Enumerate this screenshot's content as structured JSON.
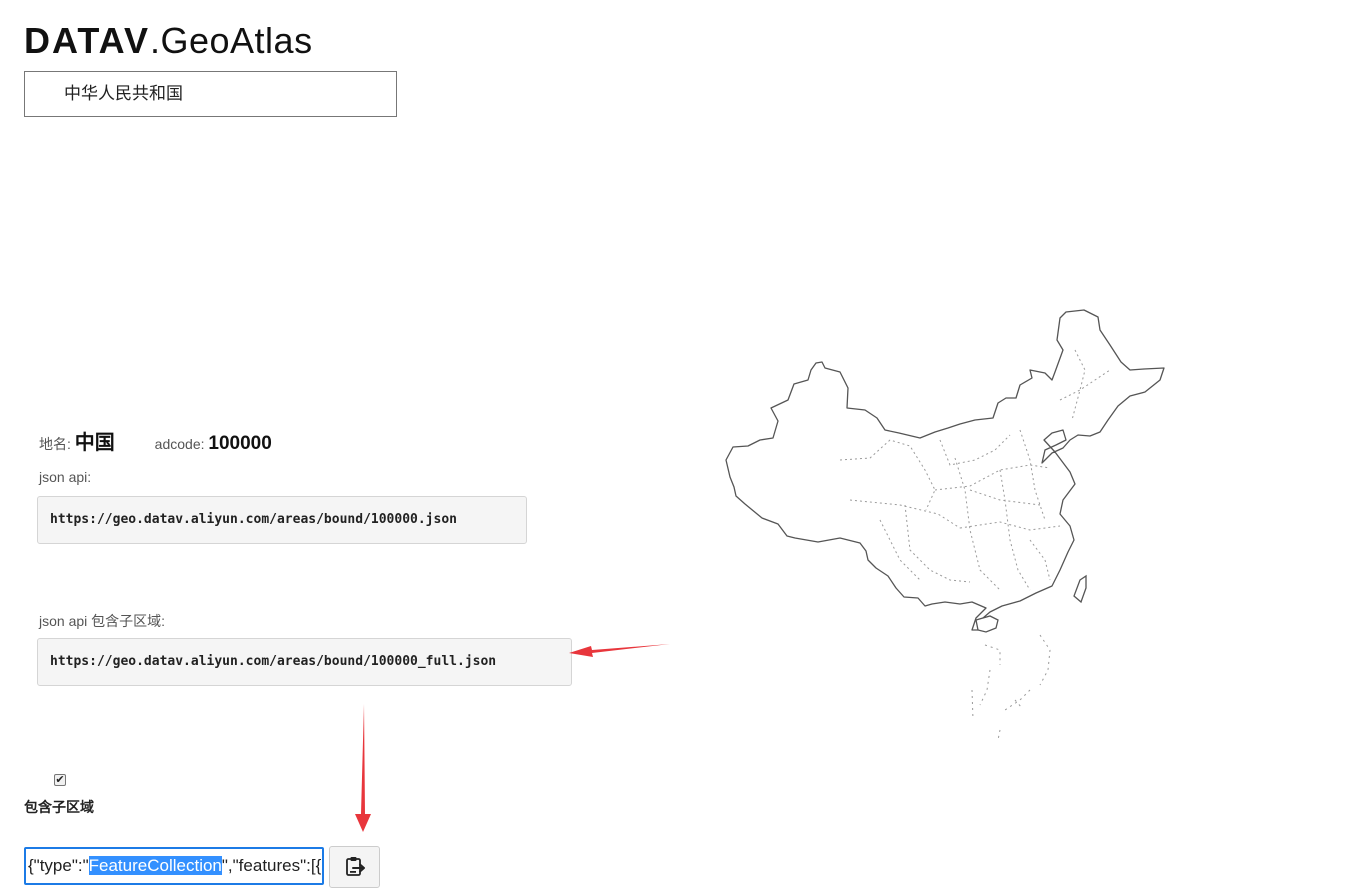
{
  "logo": {
    "brand": "DATAV",
    "product": ".GeoAtlas"
  },
  "region_select": {
    "value": "中华人民共和国"
  },
  "info": {
    "name_label": "地名:",
    "name_value": "中国",
    "adcode_label": "adcode:",
    "adcode_value": "100000"
  },
  "api": {
    "label": "json api:",
    "url": "https://geo.datav.aliyun.com/areas/bound/100000.json"
  },
  "api_full": {
    "label": "json api 包含子区域:",
    "url": "https://geo.datav.aliyun.com/areas/bound/100000_full.json"
  },
  "include_children": {
    "checked": true,
    "label": "包含子区域"
  },
  "json_output": {
    "prefix": "{\"type\":\"",
    "selected": "FeatureCollection",
    "suffix": "\",\"features\":[{"
  },
  "icons": {
    "copy": "clipboard-icon"
  },
  "colors": {
    "annotation": "#e8363c",
    "selection": "#3390ff",
    "focus": "#1c7be6"
  }
}
